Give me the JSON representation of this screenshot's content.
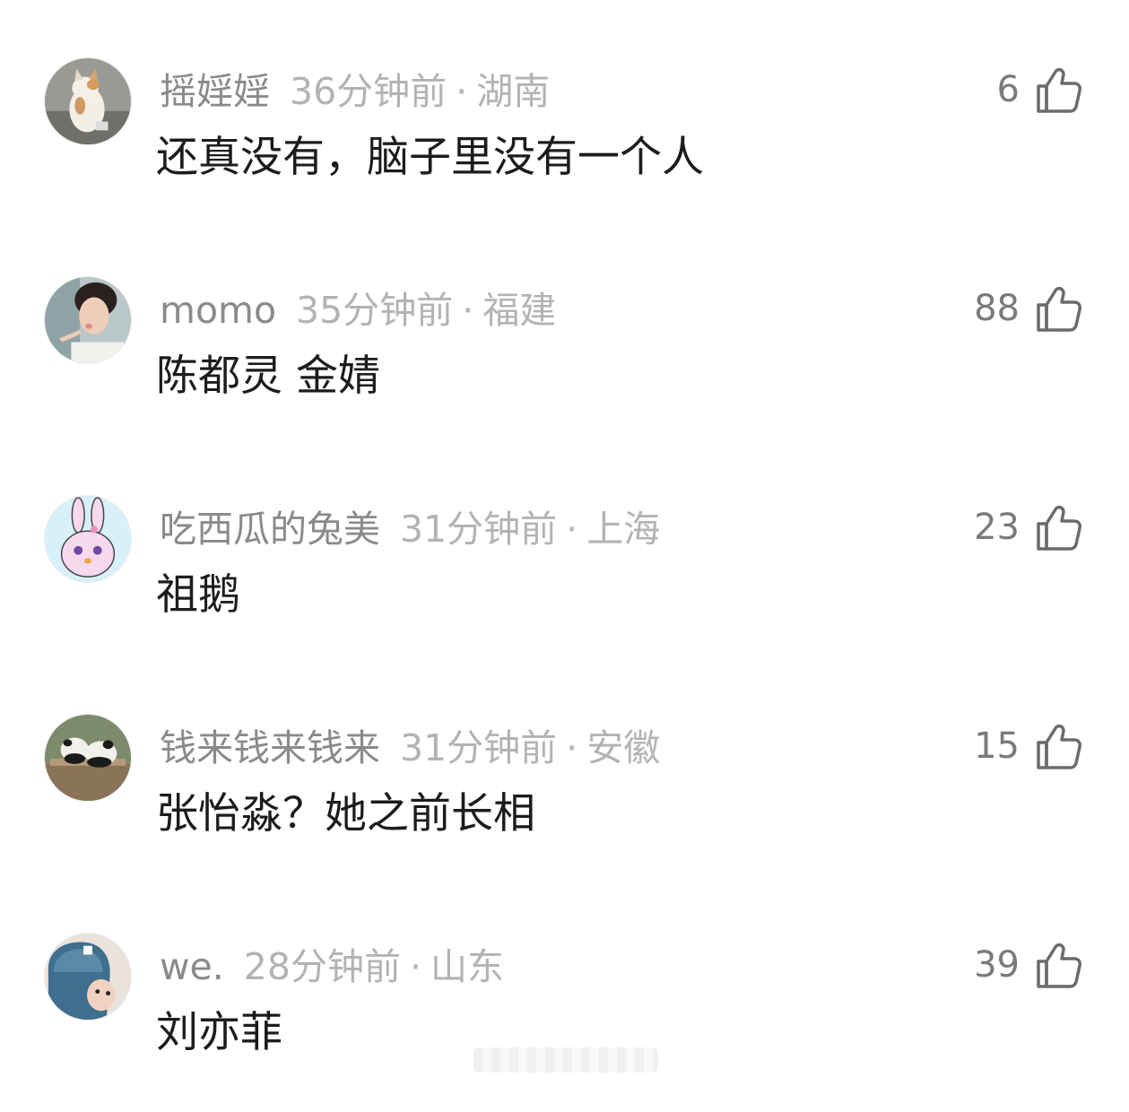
{
  "comments": [
    {
      "username": "摇婬婬",
      "time": "36分钟前",
      "region": "湖南",
      "text": "还真没有，脑子里没有一个人",
      "likes": "6",
      "avatar": "cat-photo"
    },
    {
      "username": "momo",
      "time": "35分钟前",
      "region": "福建",
      "text": "陈都灵 金婧",
      "likes": "88",
      "avatar": "girl-photo"
    },
    {
      "username": "吃西瓜的兔美",
      "time": "31分钟前",
      "region": "上海",
      "text": "祖鹅",
      "likes": "23",
      "avatar": "rabbit-cartoon"
    },
    {
      "username": "钱来钱来钱来",
      "time": "31分钟前",
      "region": "安徽",
      "text": "张怡淼？她之前长相",
      "likes": "15",
      "avatar": "panda-photo"
    },
    {
      "username": "we.",
      "time": "28分钟前",
      "region": "山东",
      "text": "刘亦菲",
      "likes": "39",
      "avatar": "blue-hat-kid-photo"
    }
  ],
  "separator": "·",
  "icons": {
    "like": "thumbs-up-icon"
  },
  "colors": {
    "username": "#8a8a8a",
    "meta": "#b3b3b3",
    "text": "#1c1c1c",
    "like_count": "#7a7a7a",
    "like_icon_stroke": "#6b6b6b"
  }
}
